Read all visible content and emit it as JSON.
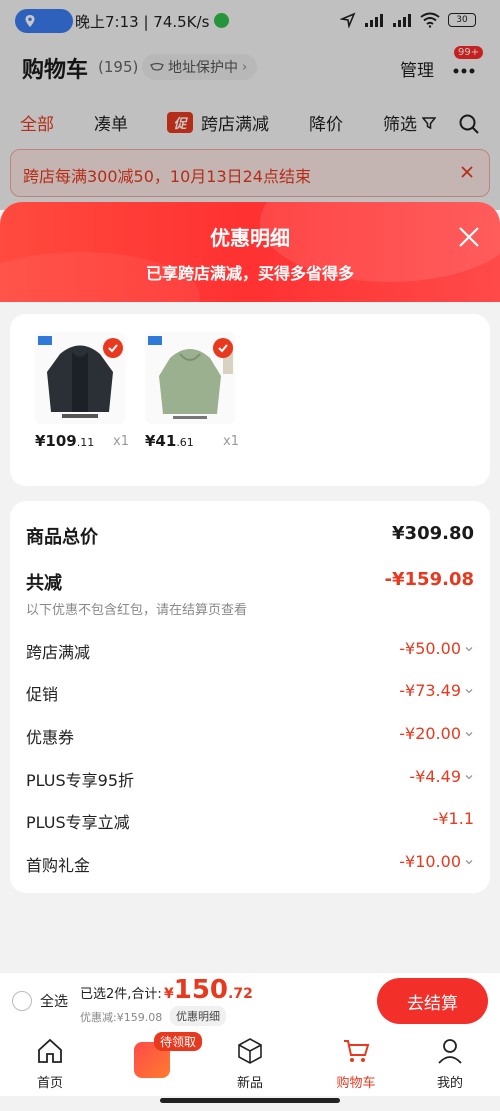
{
  "status_bar": {
    "time_text": "晚上7:13 | 74.5K/s",
    "battery": "30"
  },
  "cart_header": {
    "title": "购物车",
    "count": "(195)",
    "address_protect": "地址保护中",
    "manage": "管理",
    "badge": "99+"
  },
  "tabs": [
    {
      "label": "全部",
      "active": true
    },
    {
      "label": "凑单",
      "active": false
    },
    {
      "label": "跨店满减",
      "active": false,
      "tag": "促"
    },
    {
      "label": "降价",
      "active": false
    },
    {
      "label": "筛选",
      "active": false
    }
  ],
  "notice": {
    "text": "跨店每满300减50，10月13日24点结束"
  },
  "sheet": {
    "title": "优惠明细",
    "subtitle": "已享跨店满减，买得多省得多"
  },
  "products": [
    {
      "name": "dark hooded jacket",
      "price_int": "¥109",
      "price_dec": ".11",
      "qty": "x1",
      "color": "#2b2f36"
    },
    {
      "name": "sage green hoodie",
      "price_int": "¥41",
      "price_dec": ".61",
      "qty": "x1",
      "color": "#9bb08f"
    }
  ],
  "summary": {
    "total_label": "商品总价",
    "total_value": "¥309.80",
    "discount_label": "共减",
    "discount_value": "-¥159.08",
    "note": "以下优惠不包含红包，请在结算页查看",
    "items": [
      {
        "label": "跨店满减",
        "value": "-¥50.00",
        "chevron": true
      },
      {
        "label": "促销",
        "value": "-¥73.49",
        "chevron": true
      },
      {
        "label": "优惠券",
        "value": "-¥20.00",
        "chevron": true
      },
      {
        "label": "PLUS专享95折",
        "value": "-¥4.49",
        "chevron": true
      },
      {
        "label": "PLUS专享立减",
        "value": "-¥1.1",
        "chevron": false
      },
      {
        "label": "首购礼金",
        "value": "-¥10.00",
        "chevron": true
      }
    ]
  },
  "bottom_bar": {
    "select_all": "全选",
    "selected_text": "已选2件,合计:",
    "amount_yen": "¥",
    "amount_int": "150",
    "amount_dec": ".72",
    "discount_text": "优惠减:¥159.08",
    "detail_chip": "优惠明细",
    "checkout": "去结算"
  },
  "nav": {
    "home": "首页",
    "live_badge": "待领取",
    "new": "新品",
    "cart": "购物车",
    "mine": "我的"
  },
  "colors": {
    "accent": "#e8391f",
    "button": "#f32f2a"
  }
}
